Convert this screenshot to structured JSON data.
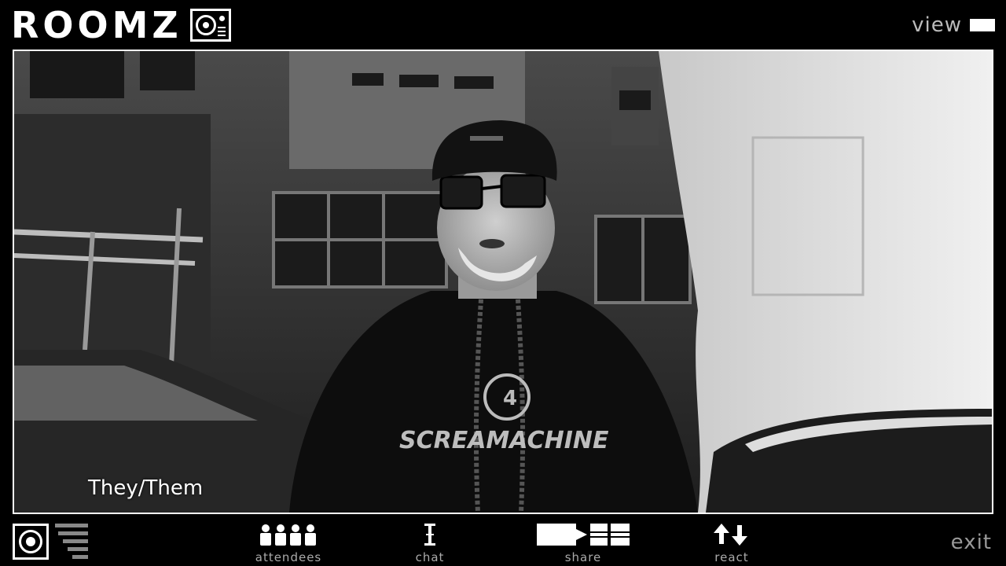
{
  "app": {
    "title": "ROOMZ"
  },
  "header": {
    "view_label": "view"
  },
  "video": {
    "pronoun_label": "They/Them",
    "shirt_text": "SCREAMACHINE"
  },
  "toolbar": {
    "attendees_label": "attendees",
    "chat_label": "chat",
    "share_label": "share",
    "react_label": "react",
    "exit_label": "exit"
  },
  "icons": {
    "logo": "turntable-icon",
    "camera": "camera-icon",
    "audio_level": "audio-level-icon",
    "attendees": "people-icon",
    "chat": "text-cursor-icon",
    "share": "share-screen-icon",
    "react": "up-down-arrows-icon",
    "view": "view-mode-icon"
  },
  "colors": {
    "background": "#000000",
    "foreground": "#ffffff",
    "muted_label": "#aaaaaa"
  }
}
